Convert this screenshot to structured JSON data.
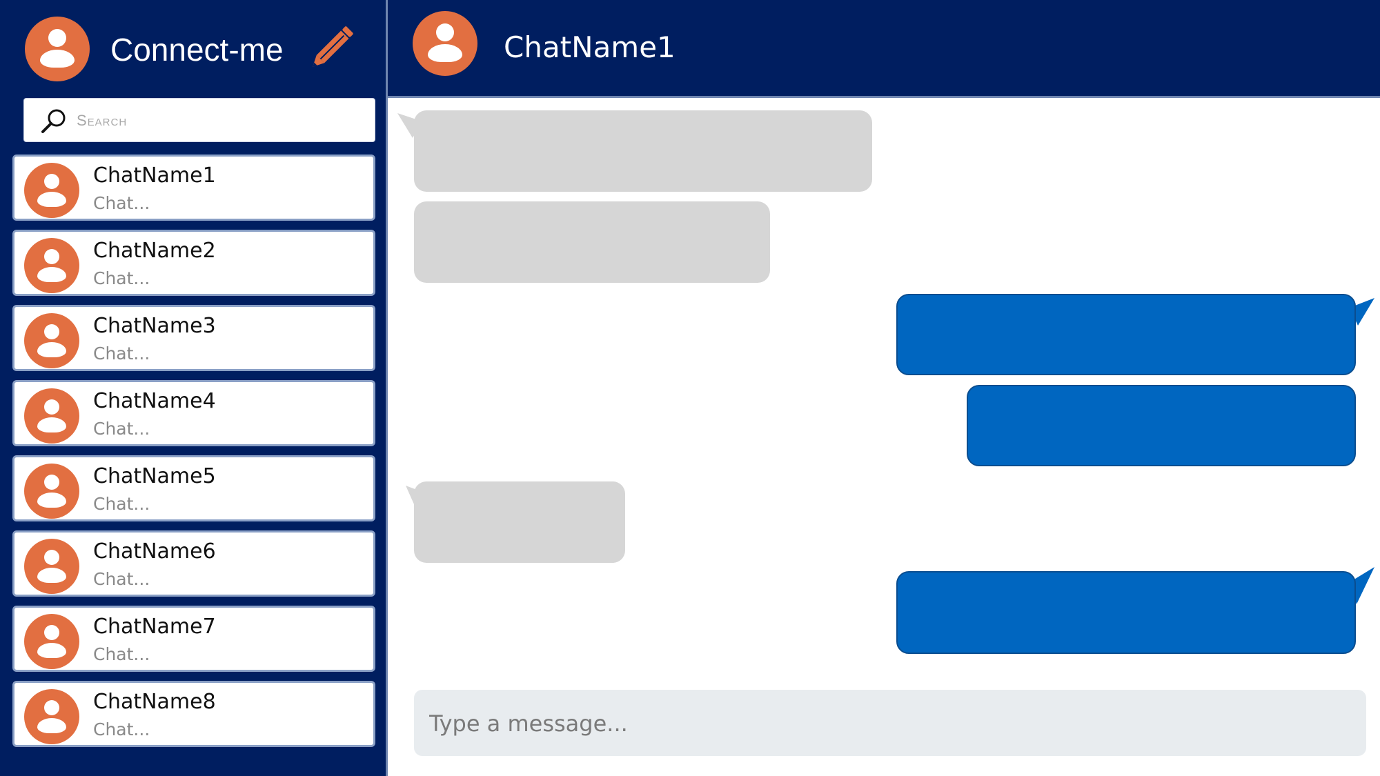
{
  "app": {
    "title": "Connect-me"
  },
  "search": {
    "placeholder": "Search"
  },
  "chats": [
    {
      "name": "ChatName1",
      "preview": "Chat..."
    },
    {
      "name": "ChatName2",
      "preview": "Chat..."
    },
    {
      "name": "ChatName3",
      "preview": "Chat..."
    },
    {
      "name": "ChatName4",
      "preview": "Chat..."
    },
    {
      "name": "ChatName5",
      "preview": "Chat..."
    },
    {
      "name": "ChatName6",
      "preview": "Chat..."
    },
    {
      "name": "ChatName7",
      "preview": "Chat..."
    },
    {
      "name": "ChatName8",
      "preview": "Chat..."
    }
  ],
  "header": {
    "chat_name": "ChatName1"
  },
  "messages": [
    {
      "direction": "incoming"
    },
    {
      "direction": "incoming"
    },
    {
      "direction": "outgoing"
    },
    {
      "direction": "outgoing"
    },
    {
      "direction": "incoming"
    },
    {
      "direction": "outgoing"
    }
  ],
  "composer": {
    "placeholder": "Type a message..."
  },
  "colors": {
    "sidebar_bg": "#001e60",
    "avatar": "#e26f41",
    "incoming_bubble": "#d6d6d6",
    "outgoing_bubble": "#0066c0",
    "composer_bg": "#e8ecef"
  },
  "icons": [
    "user-avatar-icon",
    "pencil-icon",
    "search-icon"
  ]
}
